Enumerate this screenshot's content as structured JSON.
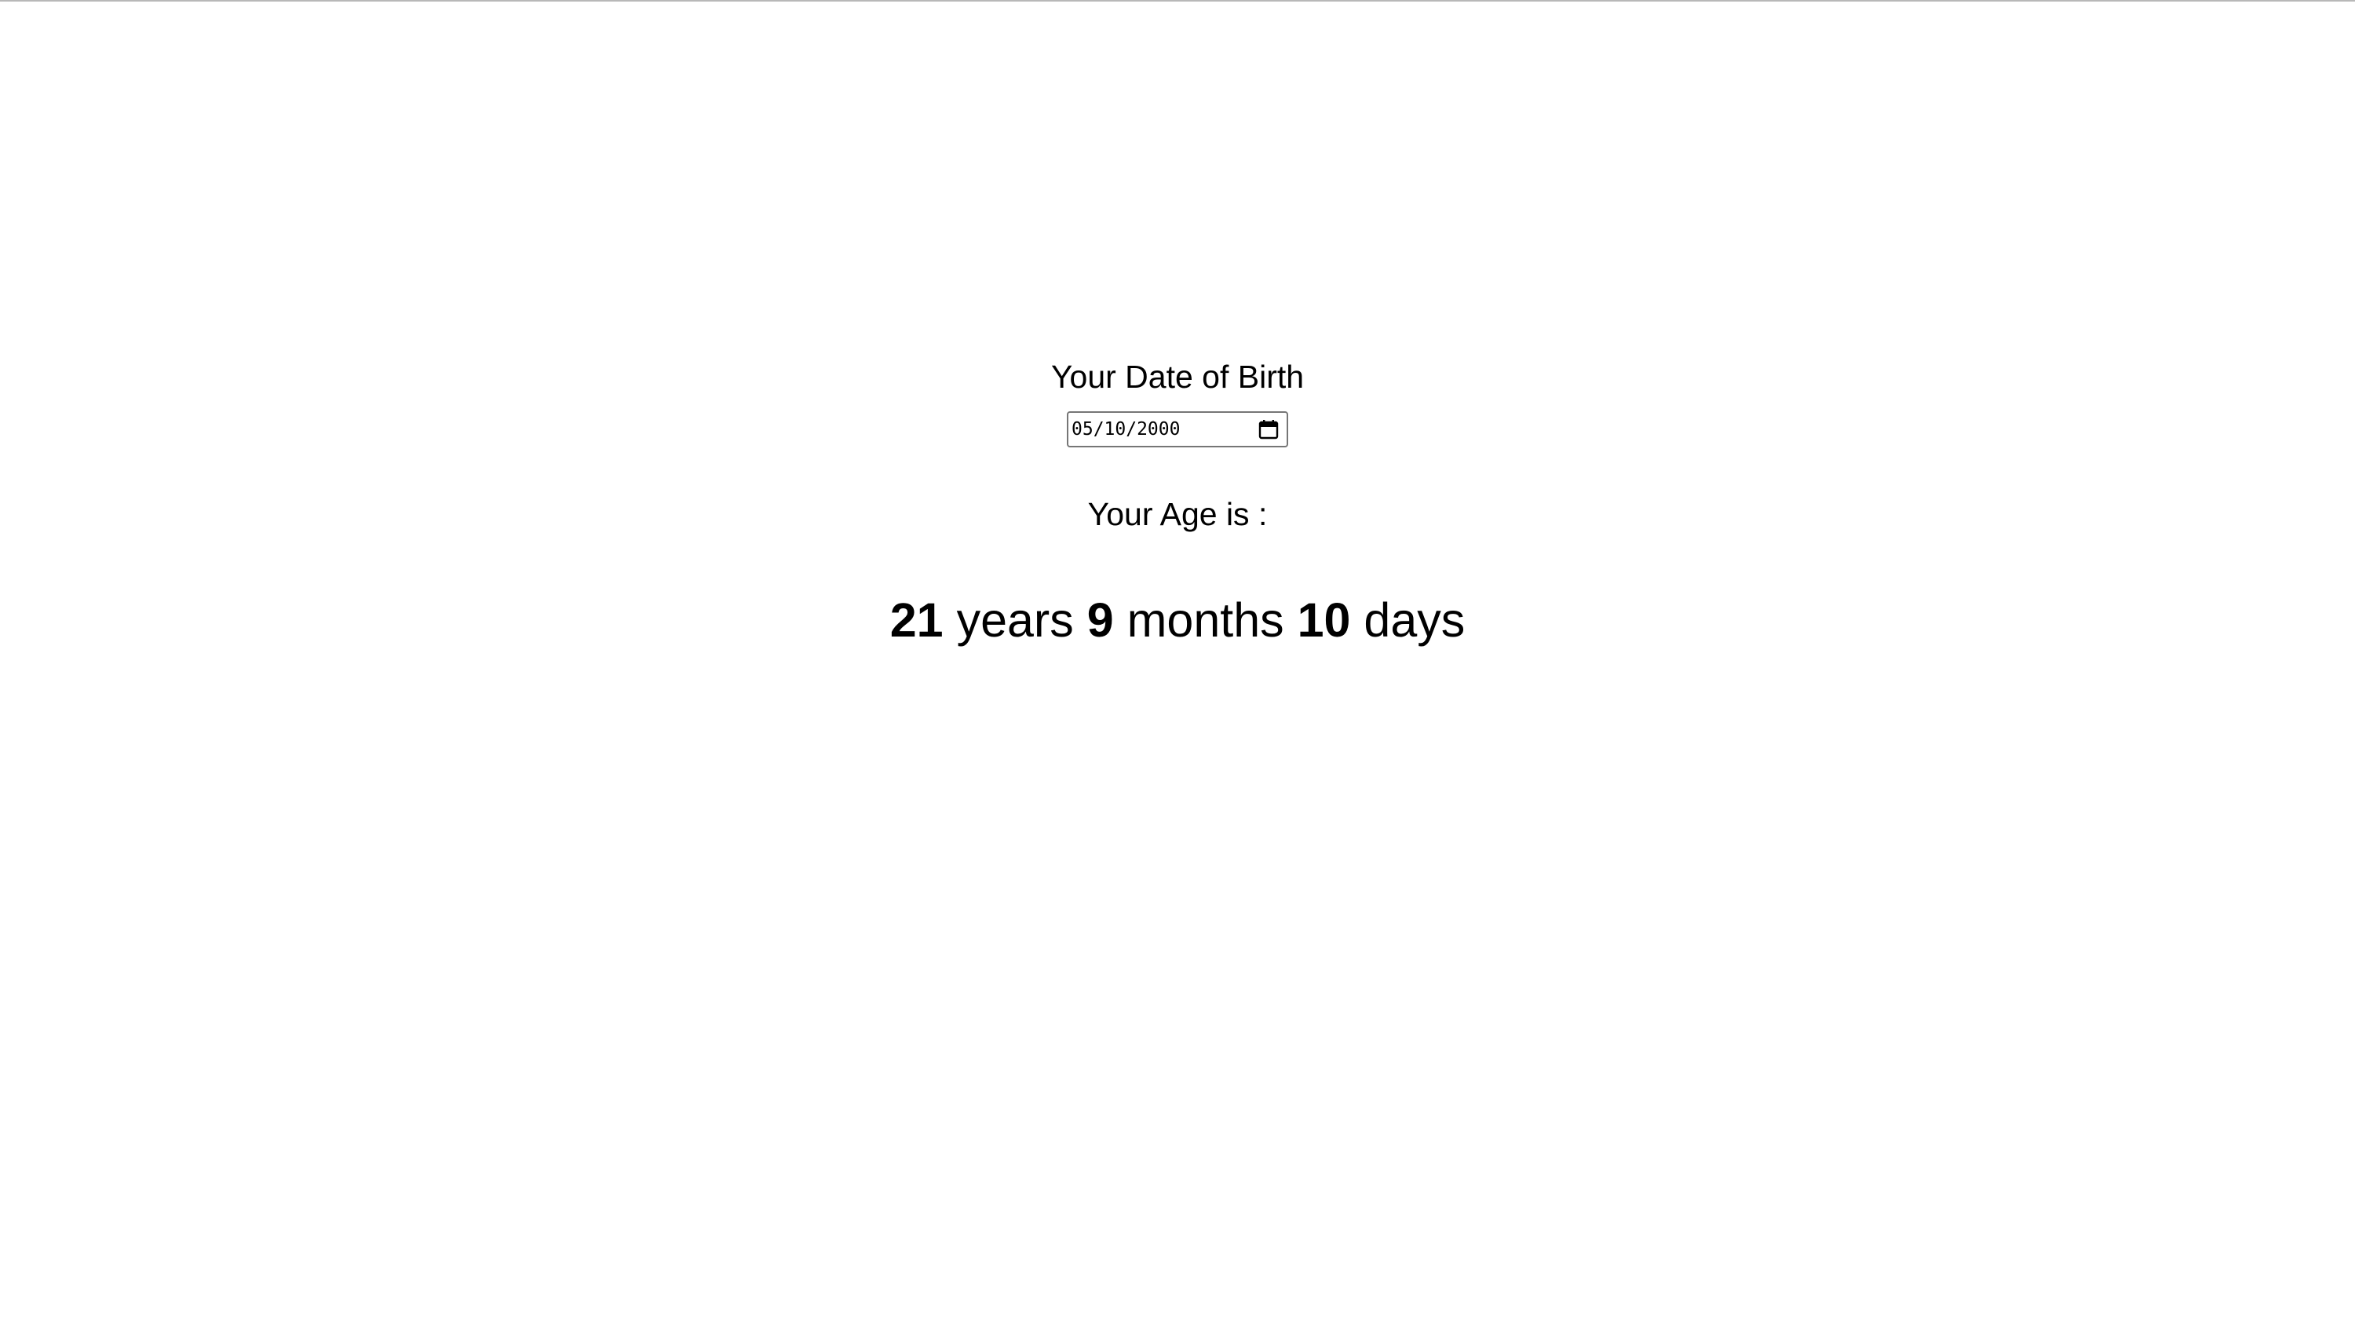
{
  "form": {
    "dob_label": "Your Date of Birth",
    "dob_value": "05/10/2000"
  },
  "result": {
    "age_label": "Your Age is :",
    "years": "21",
    "years_unit": "years",
    "months": "9",
    "months_unit": "months",
    "days": "10",
    "days_unit": "days"
  },
  "icons": {
    "calendar": "calendar-icon"
  }
}
